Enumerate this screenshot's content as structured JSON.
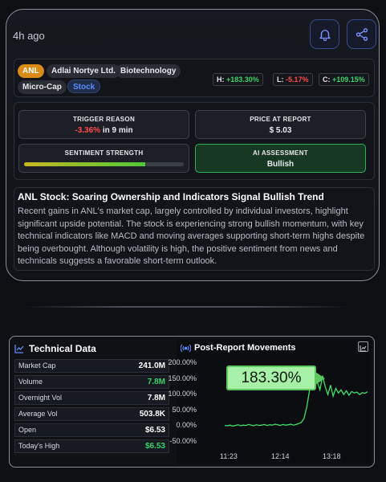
{
  "header": {
    "time_ago": "4h ago"
  },
  "tags": {
    "ticker": "ANL",
    "company": "Adlai Nortye Ltd.",
    "sector": "Biotechnology",
    "cap": "Micro-Cap",
    "type": "Stock"
  },
  "stats": {
    "high_label": "H:",
    "high_value": "+183.30%",
    "low_label": "L:",
    "low_value": "-5.17%",
    "close_label": "C:",
    "close_value": "+109.15%"
  },
  "metrics": {
    "trigger_title": "TRIGGER REASON",
    "trigger_change": "-3.36%",
    "trigger_time": "in 9 min",
    "price_title": "PRICE AT REPORT",
    "price_value": "$ 5.03",
    "sentiment_title": "SENTIMENT STRENGTH",
    "sentiment_level": 0.76,
    "ai_title": "AI ASSESSMENT",
    "ai_value": "Bullish"
  },
  "article": {
    "title": "ANL Stock: Soaring Ownership and Indicators Signal Bullish Trend",
    "body": "Recent gains in ANL's market cap, largely controlled by individual investors, highlight significant upside potential. The stock is experiencing strong bullish momentum, with key technical indicators like MACD and moving averages supporting short-term highs despite being overbought. Although volatility is high, the positive sentiment from news and technicals suggests a favorable short-term outlook."
  },
  "technical": {
    "title": "Technical Data",
    "rows": [
      {
        "label": "Market Cap",
        "value": "241.0M"
      },
      {
        "label": "Volume",
        "value": "7.8M"
      },
      {
        "label": "Overnight Vol",
        "value": "7.8M"
      },
      {
        "label": "Average Vol",
        "value": "503.8K"
      },
      {
        "label": "Open",
        "value": "$6.53"
      },
      {
        "label": "Today's High",
        "value": "$6.53"
      }
    ]
  },
  "chart": {
    "title": "Post-Report Movements",
    "callout": "183.30%"
  },
  "chart_data": {
    "type": "line",
    "yticks": [
      "200.00%",
      "150.00%",
      "100.00%",
      "50.00%",
      "0.00%",
      "-50.00%"
    ],
    "xticks": [
      "11:23",
      "12:14",
      "13:18"
    ],
    "ylim": [
      -50,
      200
    ],
    "series": [
      {
        "values": [
          2,
          1,
          3,
          0,
          2,
          4,
          1,
          3,
          2,
          5,
          3,
          1,
          4,
          2,
          3,
          5,
          2,
          4,
          3,
          6,
          4,
          2,
          5,
          3,
          4,
          6,
          3,
          5,
          8,
          12,
          25,
          60,
          110,
          150,
          183,
          140,
          115,
          160,
          125,
          100,
          130,
          95,
          120,
          105,
          115,
          100,
          112,
          98,
          110,
          105,
          108,
          100,
          106,
          104,
          109
        ]
      }
    ],
    "line_color": "#3fe06a"
  }
}
